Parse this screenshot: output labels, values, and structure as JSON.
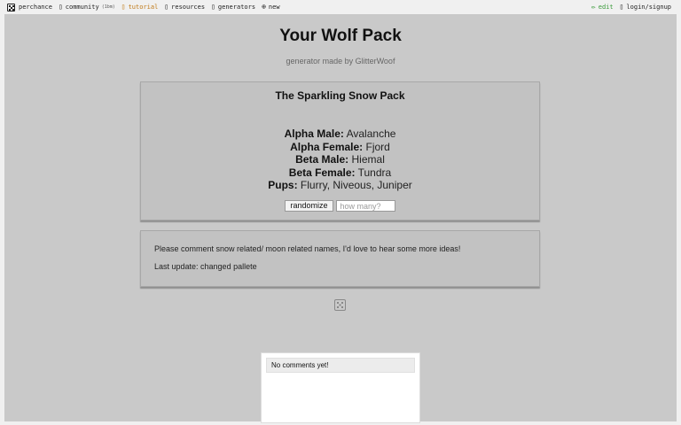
{
  "nav": {
    "brand": "perchance",
    "community": "community",
    "community_badge": "(1bm)",
    "tutorial": "tutorial",
    "resources": "resources",
    "generators": "generators",
    "new": "new",
    "edit": "edit",
    "login": "login/signup"
  },
  "page": {
    "title": "Your Wolf Pack",
    "subtitle": "generator made by GlitterWoof"
  },
  "pack": {
    "title": "The Sparkling Snow Pack",
    "rows": [
      {
        "label": "Alpha Male:",
        "value": "Avalanche"
      },
      {
        "label": "Alpha Female:",
        "value": "Fjord"
      },
      {
        "label": "Beta Male:",
        "value": "Hiemal"
      },
      {
        "label": "Beta Female:",
        "value": "Tundra"
      },
      {
        "label": "Pups:",
        "value": "Flurry, Niveous, Juniper"
      }
    ],
    "randomize_label": "randomize",
    "count_placeholder": "how many?"
  },
  "notes": {
    "line1": "Please comment snow related/ moon related names, I'd love to hear some more ideas!",
    "line2": "Last update: changed pallete"
  },
  "comments": {
    "empty_text": "No comments yet!"
  }
}
